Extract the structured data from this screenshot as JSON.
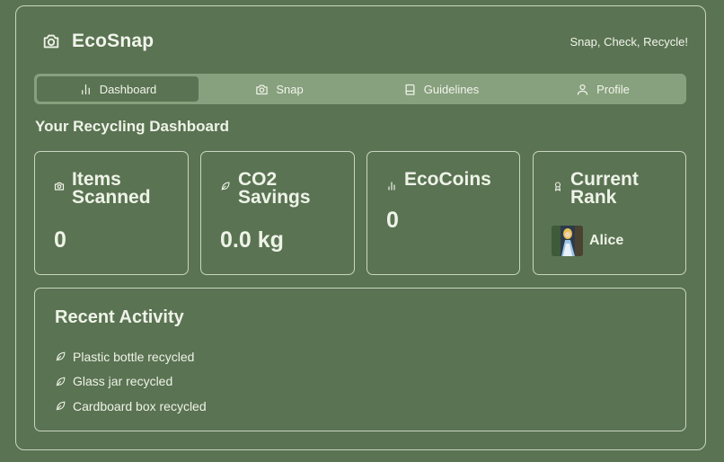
{
  "app": {
    "name": "EcoSnap",
    "tagline": "Snap, Check, Recycle!",
    "brand_icon": "camera-icon"
  },
  "tabs": [
    {
      "label": "Dashboard",
      "icon": "bar-chart-icon",
      "active": true
    },
    {
      "label": "Snap",
      "icon": "camera-icon",
      "active": false
    },
    {
      "label": "Guidelines",
      "icon": "book-icon",
      "active": false
    },
    {
      "label": "Profile",
      "icon": "user-icon",
      "active": false
    }
  ],
  "dashboard": {
    "title": "Your Recycling Dashboard",
    "cards": [
      {
        "title": "Items Scanned",
        "value": "0",
        "icon": "camera-icon"
      },
      {
        "title": "CO2 Savings",
        "value": "0.0 kg",
        "icon": "leaf-icon"
      },
      {
        "title": "EcoCoins",
        "value": "0",
        "icon": "bar-chart-icon"
      },
      {
        "title": "Current Rank",
        "user": "Alice",
        "icon": "award-icon"
      }
    ]
  },
  "activity": {
    "title": "Recent Activity",
    "items": [
      {
        "text": "Plastic bottle recycled",
        "icon": "leaf-icon"
      },
      {
        "text": "Glass jar recycled",
        "icon": "leaf-icon"
      },
      {
        "text": "Cardboard box recycled",
        "icon": "leaf-icon"
      }
    ]
  },
  "colors": {
    "background": "#5a7352",
    "tab_bar": "#87a07d",
    "border": "#c9d6c2",
    "text": "#eef3e8"
  }
}
